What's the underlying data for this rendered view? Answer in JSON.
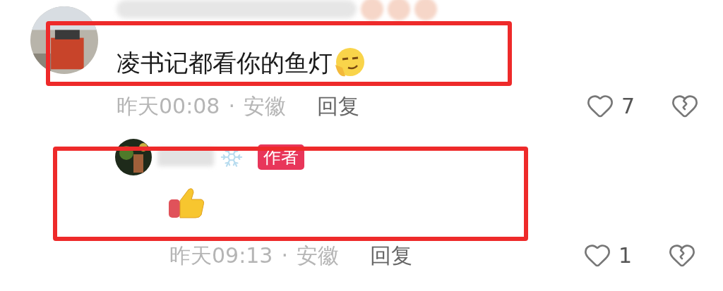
{
  "comment": {
    "highlighted": true,
    "text": "凌书记都看你的鱼灯",
    "time": "昨天00:08",
    "separator": "·",
    "location": "安徽",
    "reply_label": "回复",
    "likes": "7"
  },
  "reply": {
    "highlighted": true,
    "badge": "作者",
    "time": "昨天09:13",
    "separator": "·",
    "location": "安徽",
    "reply_label": "回复",
    "likes": "1"
  }
}
